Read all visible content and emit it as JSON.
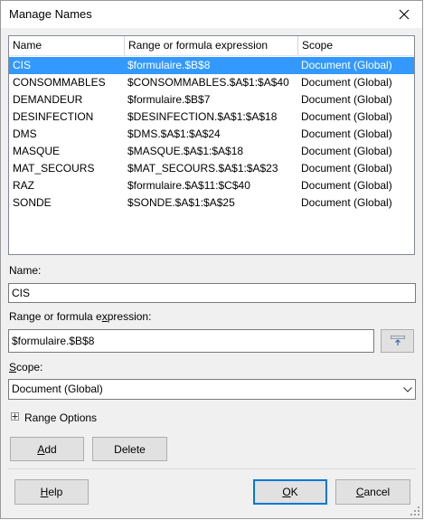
{
  "window": {
    "title": "Manage Names"
  },
  "table": {
    "columns": [
      "Name",
      "Range or formula expression",
      "Scope"
    ],
    "rows": [
      {
        "name": "CIS",
        "range": "$formulaire.$B$8",
        "scope": "Document (Global)"
      },
      {
        "name": "CONSOMMABLES",
        "range": "$CONSOMMABLES.$A$1:$A$40",
        "scope": "Document (Global)"
      },
      {
        "name": "DEMANDEUR",
        "range": "$formulaire.$B$7",
        "scope": "Document (Global)"
      },
      {
        "name": "DESINFECTION",
        "range": "$DESINFECTION.$A$1:$A$18",
        "scope": "Document (Global)"
      },
      {
        "name": "DMS",
        "range": "$DMS.$A$1:$A$24",
        "scope": "Document (Global)"
      },
      {
        "name": "MASQUE",
        "range": "$MASQUE.$A$1:$A$18",
        "scope": "Document (Global)"
      },
      {
        "name": "MAT_SECOURS",
        "range": "$MAT_SECOURS.$A$1:$A$23",
        "scope": "Document (Global)"
      },
      {
        "name": "RAZ",
        "range": "$formulaire.$A$11:$C$40",
        "scope": "Document (Global)"
      },
      {
        "name": "SONDE",
        "range": "$SONDE.$A$1:$A$25",
        "scope": "Document (Global)"
      }
    ]
  },
  "form": {
    "name_label": "Name:",
    "name_value": "CIS",
    "range_label_pre": "Range or formula e",
    "range_label_accel": "x",
    "range_label_post": "pression:",
    "range_value": "$formulaire.$B$8",
    "scope_label_accel": "S",
    "scope_label_rest": "cope:",
    "scope_value": "Document (Global)",
    "range_options_label": "Range Options"
  },
  "buttons": {
    "add_accel": "A",
    "add_rest": "dd",
    "delete": "Delete",
    "help_accel": "H",
    "help_rest": "elp",
    "ok_accel": "O",
    "ok_rest": "K",
    "cancel_pre": "",
    "cancel_accel": "C",
    "cancel_rest": "ancel"
  },
  "colors": {
    "selection": "#3399ff",
    "accent": "#0078d7"
  },
  "icons": [
    "close-icon",
    "shrink-icon",
    "chevron-down-icon",
    "expand-plus-icon",
    "resize-grip-icon"
  ]
}
